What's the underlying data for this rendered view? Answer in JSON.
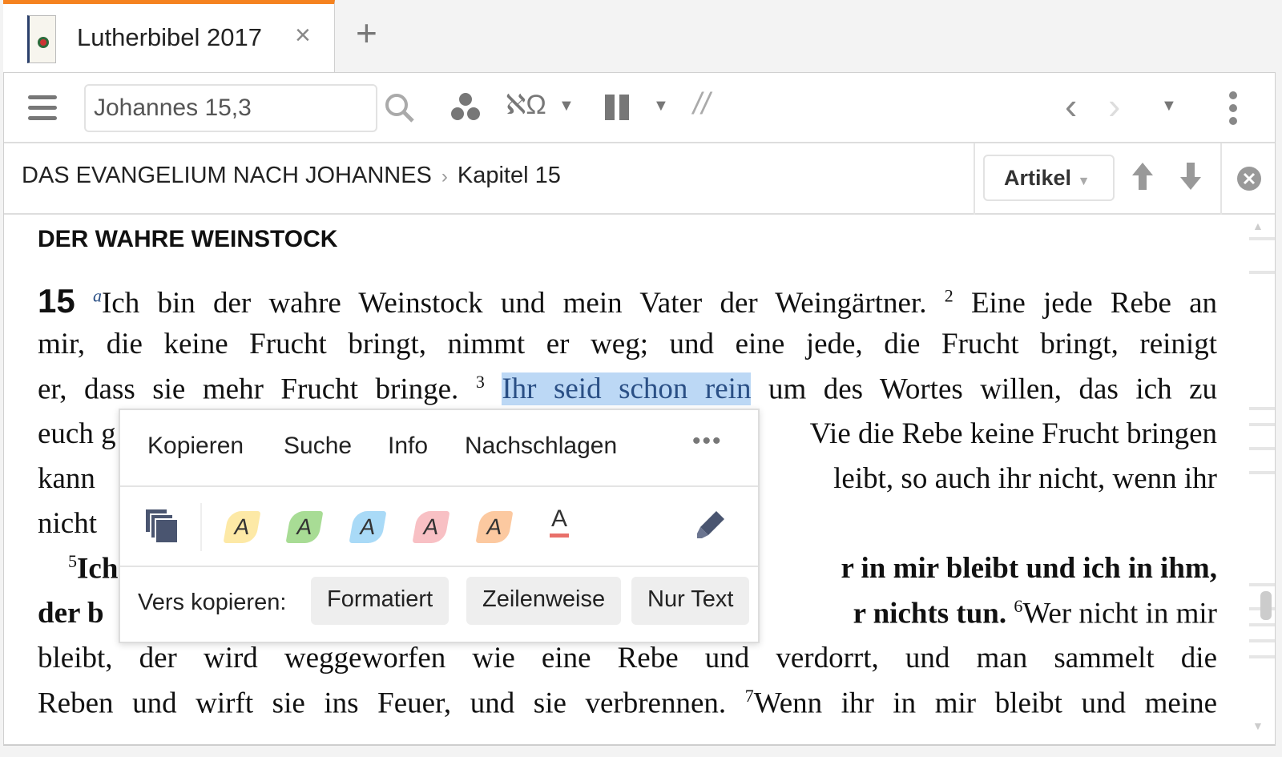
{
  "tab": {
    "title": "Lutherbibel 2017",
    "close": "×",
    "new_tab": "+"
  },
  "toolbar": {
    "search_value": "Johannes 15,3",
    "icons": [
      "menu-icon",
      "search-icon",
      "parallel-icon",
      "original-language-icon",
      "columns-icon",
      "parallel-slash-icon",
      "back-icon",
      "forward-icon",
      "history-dropdown-icon",
      "more-vertical-icon"
    ]
  },
  "breadcrumb": {
    "book": "DAS EVANGELIUM NACH JOHANNES",
    "separator": "›",
    "chapter": "Kapitel 15",
    "article_label": "Artikel"
  },
  "content": {
    "heading": "DER WAHRE WEINSTOCK",
    "chapter_num": "15",
    "footnote": "a",
    "l1": "Ich bin der wahre Weinstock und mein Vater der Weingärtner.",
    "v2": "2",
    "l1b": "Eine jede Rebe an",
    "l2": "mir, die keine Frucht bringt, nimmt er weg; und eine jede, die Frucht bringt, reinigt",
    "l3a": "er, dass sie mehr Frucht bringe.",
    "v3": "3",
    "l3sel": "Ihr seid schon rein",
    "l3b": "um des Wortes willen, das ich zu",
    "l4a": "euch g",
    "l4b": "Vie die Rebe keine Frucht bringen",
    "l5a": "kann",
    "l5b": "leibt, so auch ihr nicht, wenn ihr",
    "l6a": "nicht",
    "v5": "5",
    "l7a": "Ich",
    "l7b": "r in mir bleibt und ich in ihm,",
    "l8a": "der b",
    "l8b": "r nichts tun.",
    "v6": "6",
    "l8c": "Wer nicht in mir",
    "l9": "bleibt, der wird weggeworfen wie eine Rebe und verdorrt, und man sammelt die",
    "l10": "Reben und wirft sie ins Feuer, und sie verbrennen.",
    "v7": "7",
    "l10b": "Wenn ihr in mir bleibt und meine"
  },
  "popup": {
    "actions": [
      "Kopieren",
      "Suche",
      "Info",
      "Nachschlagen"
    ],
    "more": "•••",
    "highlight_letter": "A",
    "highlight_colors": [
      "#fde9a6",
      "#a8dc95",
      "#a9daf7",
      "#f8c0c4",
      "#fcc9a0"
    ],
    "underline_color": "#e8706a",
    "copy_label": "Vers kopieren:",
    "copy_buttons": [
      "Formatiert",
      "Zeilenweise",
      "Nur Text"
    ]
  },
  "colors": {
    "accent": "#f5821f",
    "selection": "#bcd8f5"
  }
}
